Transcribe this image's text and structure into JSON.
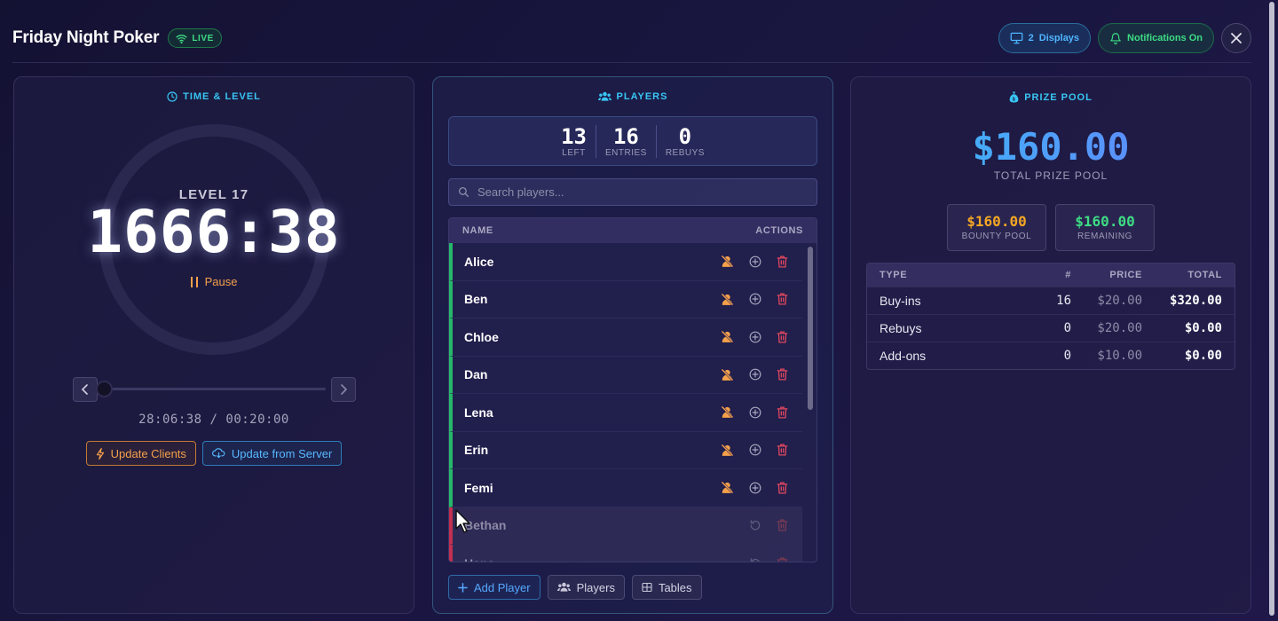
{
  "header": {
    "title": "Friday Night Poker",
    "live_label": "LIVE",
    "displays_count": "2",
    "displays_label": "Displays",
    "notifications_label": "Notifications On"
  },
  "time_panel": {
    "title": "TIME & LEVEL",
    "level_label": "LEVEL 17",
    "clock": "1666:38",
    "pause_label": "Pause",
    "level_progress": 0.0,
    "elapsed": "28:06:38 / 00:20:00",
    "update_clients_label": "Update Clients",
    "update_server_label": "Update from Server"
  },
  "players_panel": {
    "title": "PLAYERS",
    "stats": [
      {
        "value": "13",
        "label": "LEFT"
      },
      {
        "value": "16",
        "label": "ENTRIES"
      },
      {
        "value": "0",
        "label": "REBUYS"
      }
    ],
    "search_placeholder": "Search players...",
    "col_name": "NAME",
    "col_actions": "ACTIONS",
    "rows": [
      {
        "name": "Alice",
        "status": "active"
      },
      {
        "name": "Ben",
        "status": "active"
      },
      {
        "name": "Chloe",
        "status": "active"
      },
      {
        "name": "Dan",
        "status": "active"
      },
      {
        "name": "Lena",
        "status": "active"
      },
      {
        "name": "Erin",
        "status": "active"
      },
      {
        "name": "Femi",
        "status": "active"
      },
      {
        "name": "Bethan",
        "status": "eliminated"
      },
      {
        "name": "Hana",
        "status": "eliminated"
      }
    ],
    "add_player_label": "Add Player",
    "players_btn_label": "Players",
    "tables_btn_label": "Tables"
  },
  "prize_panel": {
    "title": "PRIZE POOL",
    "total": "$160.00",
    "total_label": "TOTAL PRIZE POOL",
    "bounty_value": "$160.00",
    "bounty_label": "BOUNTY POOL",
    "remaining_value": "$160.00",
    "remaining_label": "REMAINING",
    "table_headers": [
      "TYPE",
      "#",
      "PRICE",
      "TOTAL"
    ],
    "table_rows": [
      {
        "type": "Buy-ins",
        "count": "16",
        "price": "$20.00",
        "total": "$320.00"
      },
      {
        "type": "Rebuys",
        "count": "0",
        "price": "$20.00",
        "total": "$0.00"
      },
      {
        "type": "Add-ons",
        "count": "0",
        "price": "$10.00",
        "total": "$0.00"
      }
    ]
  },
  "colors": {
    "accent_cyan": "#38c6f4",
    "live_green": "#3ddc84",
    "warn_orange": "#f5a04a",
    "danger_red": "#e2485f",
    "bounty_orange": "#f5a623",
    "remaining_green": "#3ddc84"
  }
}
